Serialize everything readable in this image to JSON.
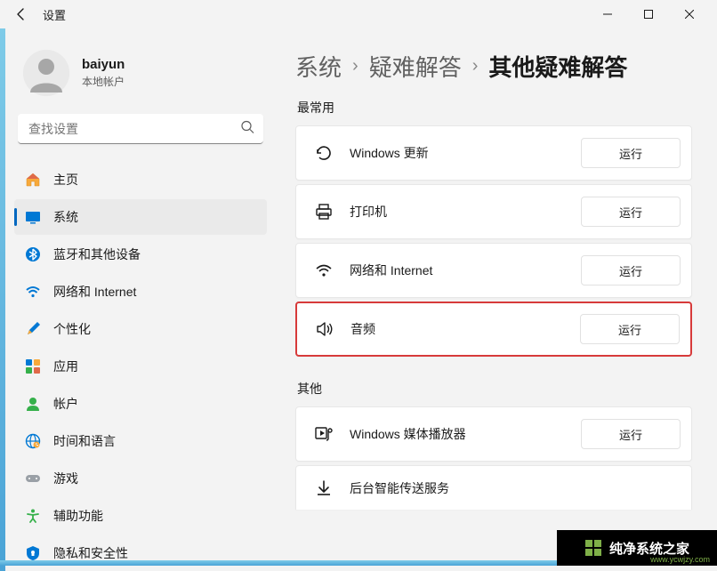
{
  "titlebar": {
    "title": "设置"
  },
  "user": {
    "name": "baiyun",
    "type": "本地帐户"
  },
  "search": {
    "placeholder": "查找设置"
  },
  "nav": {
    "items": [
      {
        "label": "主页"
      },
      {
        "label": "系统"
      },
      {
        "label": "蓝牙和其他设备"
      },
      {
        "label": "网络和 Internet"
      },
      {
        "label": "个性化"
      },
      {
        "label": "应用"
      },
      {
        "label": "帐户"
      },
      {
        "label": "时间和语言"
      },
      {
        "label": "游戏"
      },
      {
        "label": "辅助功能"
      },
      {
        "label": "隐私和安全性"
      }
    ],
    "selected_index": 1
  },
  "breadcrumbs": {
    "parts": [
      "系统",
      "疑难解答",
      "其他疑难解答"
    ]
  },
  "sections": {
    "frequent": {
      "title": "最常用",
      "items": [
        {
          "label": "Windows 更新",
          "action": "运行"
        },
        {
          "label": "打印机",
          "action": "运行"
        },
        {
          "label": "网络和 Internet",
          "action": "运行"
        },
        {
          "label": "音频",
          "action": "运行",
          "highlight": true
        }
      ]
    },
    "other": {
      "title": "其他",
      "items": [
        {
          "label": "Windows 媒体播放器",
          "action": "运行"
        },
        {
          "label": "后台智能传送服务",
          "action": ""
        }
      ]
    }
  },
  "watermark": {
    "text": "纯净系统之家",
    "url": "www.ycwjzy.com"
  }
}
